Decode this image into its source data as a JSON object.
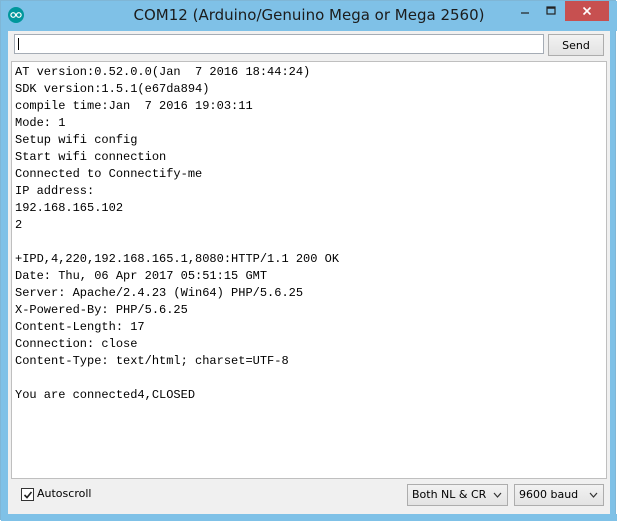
{
  "window": {
    "title": "COM12 (Arduino/Genuino Mega or Mega 2560)",
    "app_icon": "arduino-icon",
    "controls": {
      "minimize_icon": "minimize-icon",
      "maximize_icon": "maximize-icon",
      "close_icon": "close-icon"
    },
    "colors": {
      "titlebar": "#7fc1e7",
      "close_button": "#c75050",
      "app_icon": "#00979c"
    }
  },
  "input": {
    "value": "",
    "send_label": "Send"
  },
  "output": {
    "lines": [
      "AT version:0.52.0.0(Jan  7 2016 18:44:24)",
      "SDK version:1.5.1(e67da894)",
      "compile time:Jan  7 2016 19:03:11",
      "Mode: 1",
      "Setup wifi config",
      "Start wifi connection",
      "Connected to Connectify-me",
      "IP address:",
      "192.168.165.102",
      "2",
      "",
      "+IPD,4,220,192.168.165.1,8080:HTTP/1.1 200 OK",
      "Date: Thu, 06 Apr 2017 05:51:15 GMT",
      "Server: Apache/2.4.23 (Win64) PHP/5.6.25",
      "X-Powered-By: PHP/5.6.25",
      "Content-Length: 17",
      "Connection: close",
      "Content-Type: text/html; charset=UTF-8",
      "",
      "You are connected4,CLOSED"
    ]
  },
  "footer": {
    "autoscroll_label": "Autoscroll",
    "autoscroll_checked": true,
    "line_ending": "Both NL & CR",
    "baud_rate": "9600 baud"
  }
}
